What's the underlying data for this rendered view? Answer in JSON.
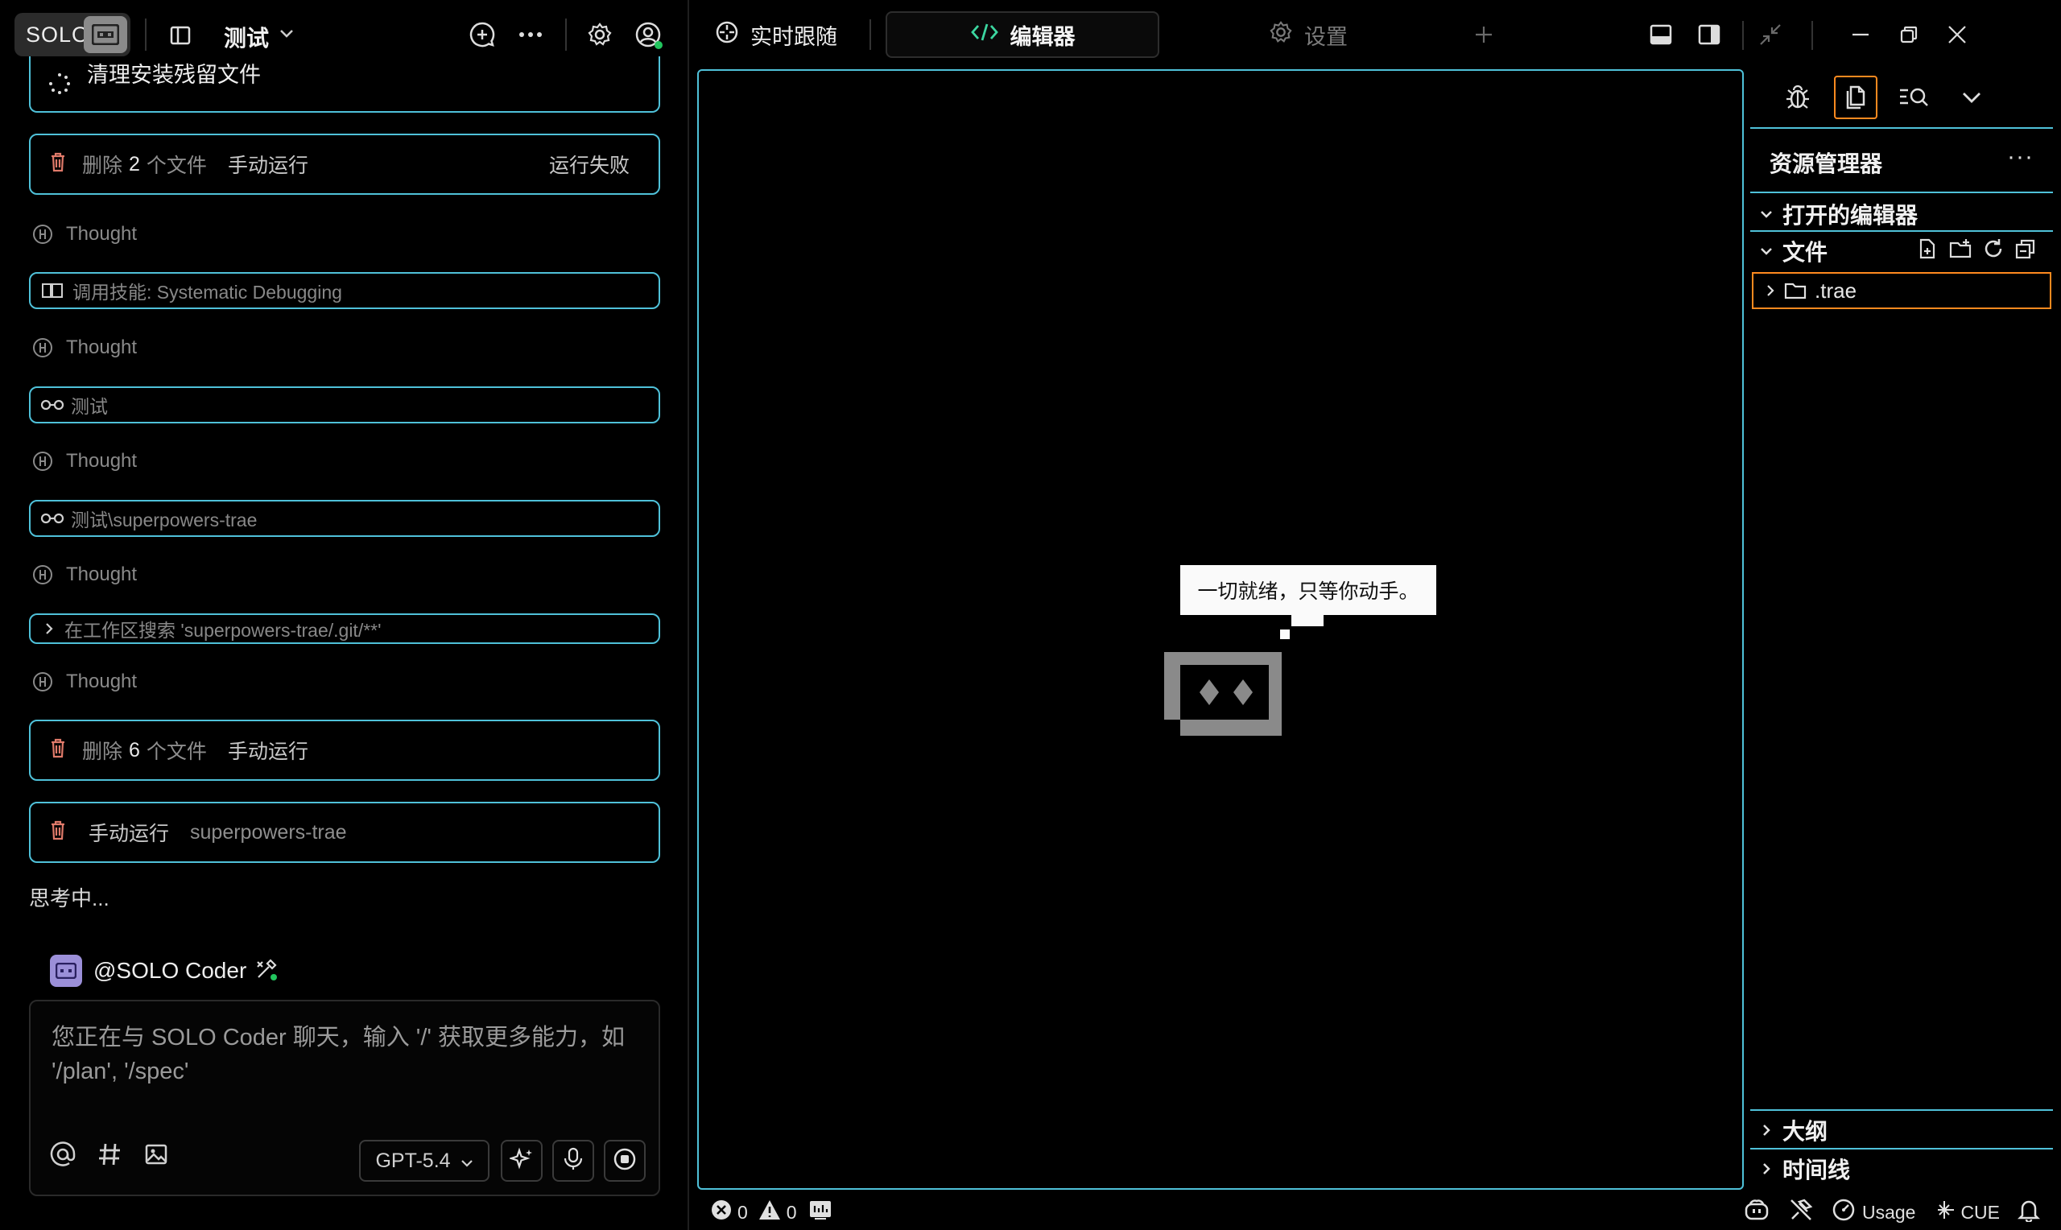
{
  "app": {
    "badge_label": "SOLO",
    "project_name": "测试"
  },
  "colors": {
    "accent_cyan": "#4fc1d9",
    "selected_orange": "#ff8a1f",
    "delete_icon_red": "#e07a6a",
    "online_green": "#22c55e",
    "agent_avatar_purple": "#9b8fd8"
  },
  "chat": {
    "task_cleanup": "清理安装残留文件",
    "card_delete_2": {
      "action": "删除",
      "count": "2",
      "unit": "个文件",
      "mode": "手动运行",
      "status": "运行失败"
    },
    "thought_label": "Thought",
    "skill_call": "调用技能: Systematic Debugging",
    "browse_1": "测试",
    "browse_2": "测试\\superpowers-trae",
    "search_ws": "在工作区搜索 'superpowers-trae/.git/**'",
    "card_delete_6": {
      "action": "删除",
      "count": "6",
      "unit": "个文件",
      "mode": "手动运行"
    },
    "card_run": {
      "mode": "手动运行",
      "target": "superpowers-trae"
    },
    "thinking": "思考中..."
  },
  "composer": {
    "agent_name": "@SOLO Coder",
    "placeholder": "您正在与 SOLO Coder 聊天，输入 '/' 获取更多能力，如 '/plan', '/spec'",
    "model": "GPT-5.4"
  },
  "tabs": {
    "live_follow": "实时跟随",
    "editor": "编辑器",
    "settings": "设置"
  },
  "editor": {
    "empty_message": "一切就绪，只等你动手。"
  },
  "explorer": {
    "title": "资源管理器",
    "more": "···",
    "open_editors": "打开的编辑器",
    "files": "文件",
    "tree_item": ".trae",
    "outline": "大纲",
    "timeline": "时间线"
  },
  "status": {
    "errors": "0",
    "warnings": "0",
    "usage": "Usage",
    "cue": "CUE"
  }
}
